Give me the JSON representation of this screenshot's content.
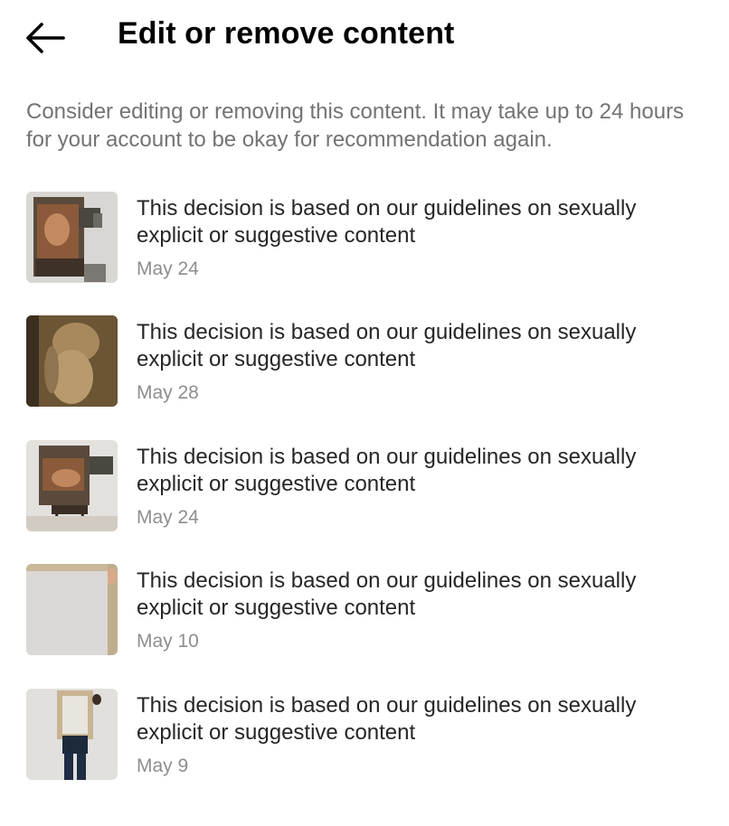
{
  "header": {
    "title": "Edit or remove content",
    "back_icon": "arrow-left-icon"
  },
  "intro": "Consider editing or removing this content. It may take up to 24 hours for your account to be okay for recommendation again.",
  "items": [
    {
      "thumbnail": "artwork-box-figure",
      "text": "This decision is based on our guidelines on sexually explicit or suggestive content",
      "date": "May 24"
    },
    {
      "thumbnail": "sepia-figure-painting",
      "text": "This decision is based on our guidelines on sexually explicit or suggestive content",
      "date": "May 28"
    },
    {
      "thumbnail": "artwork-box-figure-stool",
      "text": "This decision is based on our guidelines on sexually explicit or suggestive content",
      "date": "May 24"
    },
    {
      "thumbnail": "blank-canvas",
      "text": "This decision is based on our guidelines on sexually explicit or suggestive content",
      "date": "May 10"
    },
    {
      "thumbnail": "person-holding-frame",
      "text": "This decision is based on our guidelines on sexually explicit or suggestive content",
      "date": "May 9"
    }
  ]
}
